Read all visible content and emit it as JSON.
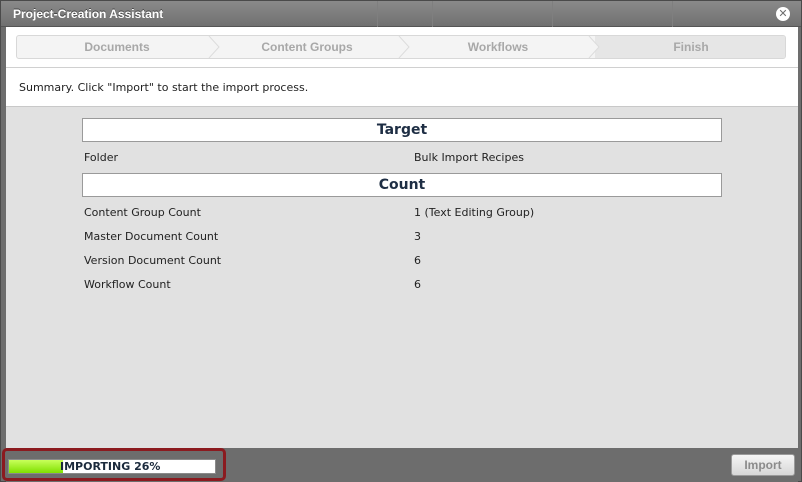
{
  "window": {
    "title": "Project-Creation Assistant",
    "close_icon": "close-icon"
  },
  "wizard": {
    "steps": [
      {
        "label": "Documents"
      },
      {
        "label": "Content Groups"
      },
      {
        "label": "Workflows"
      },
      {
        "label": "Finish",
        "active": true
      }
    ]
  },
  "instruction": "Summary. Click \"Import\" to start the import process.",
  "summary": {
    "target": {
      "header": "Target",
      "rows": [
        {
          "label": "Folder",
          "value": "Bulk Import Recipes"
        }
      ]
    },
    "count": {
      "header": "Count",
      "rows": [
        {
          "label": "Content Group Count",
          "value": "1 (Text Editing Group)"
        },
        {
          "label": "Master Document Count",
          "value": "3"
        },
        {
          "label": "Version Document Count",
          "value": "6"
        },
        {
          "label": "Workflow Count",
          "value": "6"
        }
      ]
    }
  },
  "footer": {
    "progress_label": "IMPORTING 26%",
    "progress_fraction": 0.26,
    "import_label": "Import"
  },
  "colors": {
    "progress_fill": "#7fe000",
    "highlight_frame": "#8b1a1f",
    "header_text": "#1e2e44"
  }
}
